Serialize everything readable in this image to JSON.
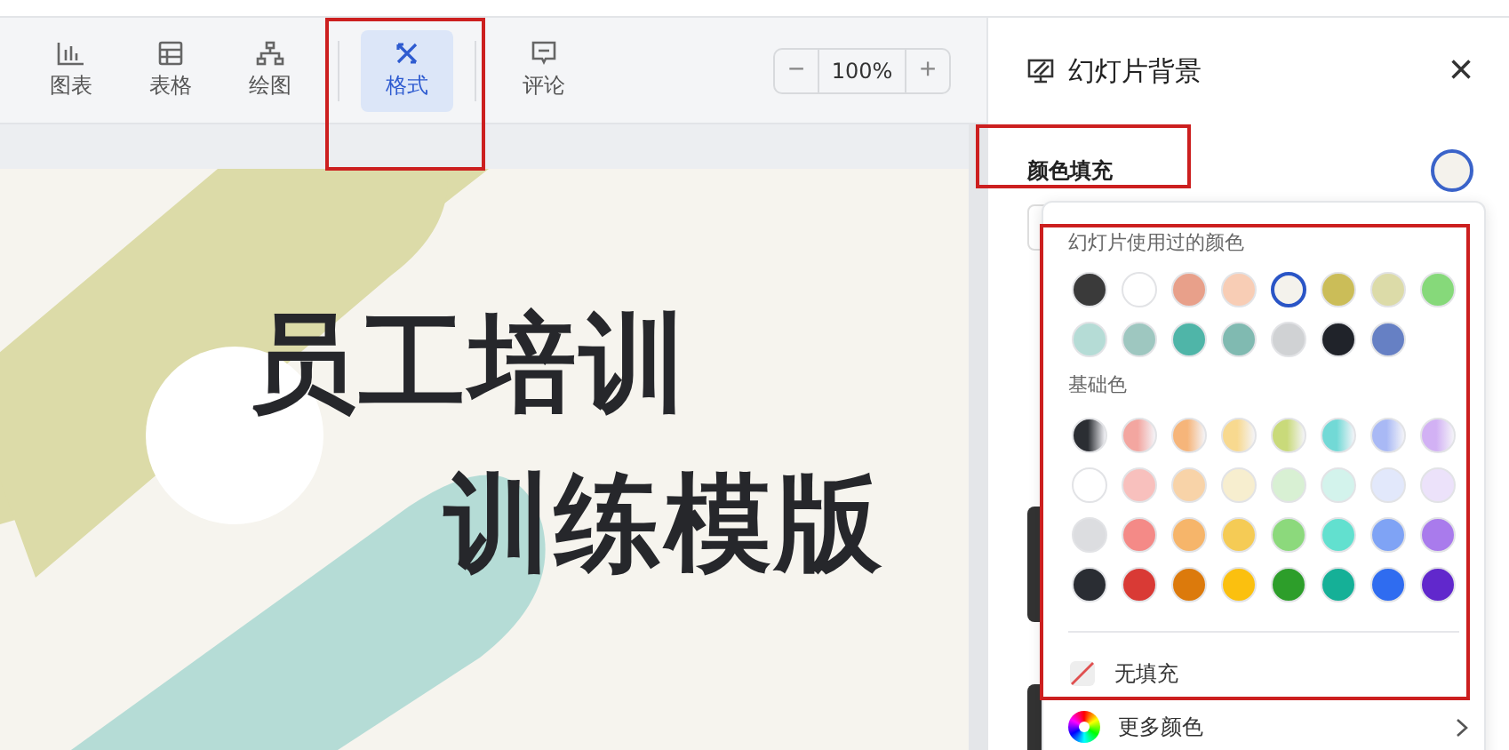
{
  "toolbar": {
    "items": [
      {
        "label": "图表",
        "selected": false
      },
      {
        "label": "表格",
        "selected": false
      },
      {
        "label": "绘图",
        "selected": false
      },
      {
        "label": "格式",
        "selected": true
      },
      {
        "label": "评论",
        "selected": false
      }
    ],
    "zoom": {
      "minus": "−",
      "value": "100%",
      "plus": "+"
    }
  },
  "slide": {
    "title": "员工培训",
    "subtitle": "训练模版"
  },
  "panel": {
    "title": "幻灯片背景",
    "close": "×",
    "fill_label": "颜色填充",
    "fill_swatch": {
      "color": "#f4f2ec"
    }
  },
  "picker": {
    "used_title": "幻灯片使用过的颜色",
    "used_colors": [
      {
        "color": "#3a3a3a",
        "selected": false
      },
      {
        "color": "#ffffff",
        "selected": false
      },
      {
        "color": "#e8a08a",
        "selected": false
      },
      {
        "color": "#f8cdb5",
        "selected": false
      },
      {
        "color": "#f4f2ec",
        "selected": true
      },
      {
        "color": "#cbbd58",
        "selected": false
      },
      {
        "color": "#dcdba8",
        "selected": false
      },
      {
        "color": "#86d97a",
        "selected": false
      },
      {
        "color": "#b5dcd6",
        "selected": false
      },
      {
        "color": "#9ec7c0",
        "selected": false
      },
      {
        "color": "#4fb5a8",
        "selected": false
      },
      {
        "color": "#80bab1",
        "selected": false
      },
      {
        "color": "#d0d2d4",
        "selected": false
      },
      {
        "color": "#20232a",
        "selected": false
      },
      {
        "color": "#6680c4",
        "selected": false
      }
    ],
    "base_title": "基础色",
    "base_rows": [
      {
        "kind": "gradient",
        "colors": [
          {
            "color": "#2b2e33"
          },
          {
            "color": "#f3a6a0"
          },
          {
            "color": "#f6b57a"
          },
          {
            "color": "#f8d98f"
          },
          {
            "color": "#c9da7a"
          },
          {
            "color": "#72d9d6"
          },
          {
            "color": "#a9b9f5"
          },
          {
            "color": "#d2b1f4"
          }
        ]
      },
      {
        "kind": "solid",
        "colors": [
          {
            "color": "#ffffff"
          },
          {
            "color": "#f8c0bd"
          },
          {
            "color": "#f8d3a8"
          },
          {
            "color": "#f7eecf"
          },
          {
            "color": "#d8f0d3"
          },
          {
            "color": "#d3f3ec"
          },
          {
            "color": "#e2e8fb"
          },
          {
            "color": "#ece2fa"
          }
        ]
      },
      {
        "kind": "solid",
        "colors": [
          {
            "color": "#dcdde0"
          },
          {
            "color": "#f48a87"
          },
          {
            "color": "#f6b56a"
          },
          {
            "color": "#f5cb55"
          },
          {
            "color": "#8cd97c"
          },
          {
            "color": "#62e0cf"
          },
          {
            "color": "#7fa3f5"
          },
          {
            "color": "#a97bec"
          }
        ]
      },
      {
        "kind": "solid",
        "colors": [
          {
            "color": "#2a2d33"
          },
          {
            "color": "#d93a35"
          },
          {
            "color": "#dc7a0c"
          },
          {
            "color": "#fbc00f"
          },
          {
            "color": "#2d9e2a"
          },
          {
            "color": "#15b097"
          },
          {
            "color": "#2f6cf0"
          },
          {
            "color": "#6128cc"
          }
        ]
      }
    ],
    "no_fill": "无填充",
    "more_colors": "更多颜色"
  }
}
